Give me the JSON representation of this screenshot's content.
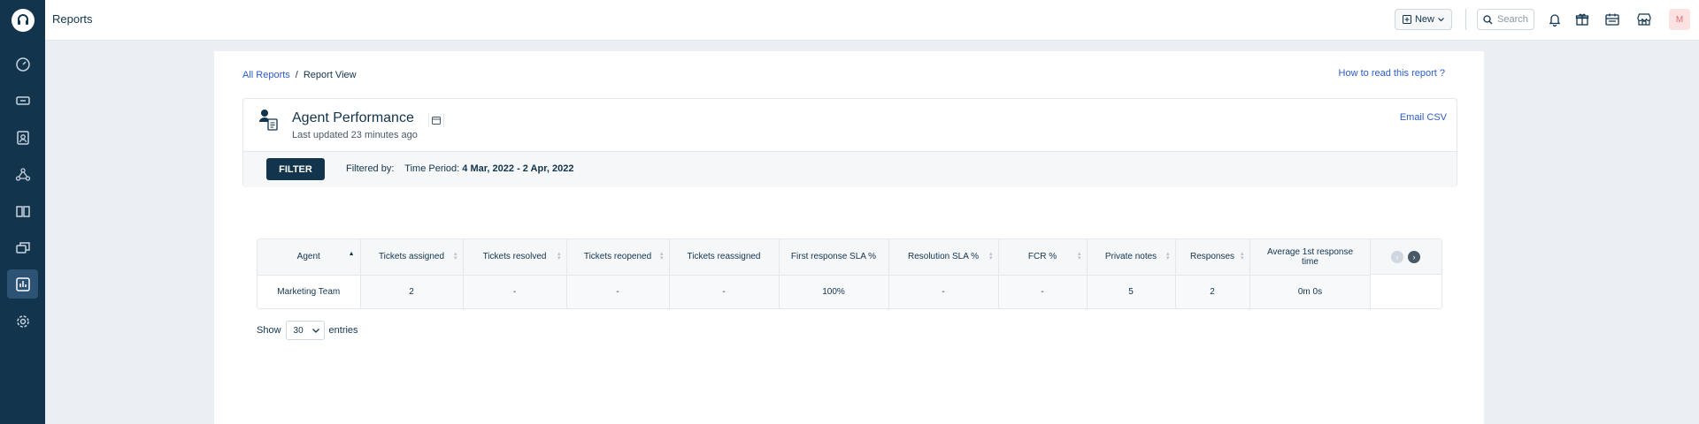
{
  "header": {
    "title": "Reports",
    "new_label": "New",
    "search_placeholder": "Search",
    "avatar_initial": "M"
  },
  "sidebar": {
    "items": [
      {
        "icon": "dashboard-icon"
      },
      {
        "icon": "tickets-icon"
      },
      {
        "icon": "contacts-icon"
      },
      {
        "icon": "groups-icon"
      },
      {
        "icon": "solutions-icon"
      },
      {
        "icon": "forums-icon"
      },
      {
        "icon": "reports-icon",
        "active": true
      },
      {
        "icon": "admin-gear-icon"
      }
    ]
  },
  "breadcrumb": {
    "root": "All Reports",
    "separator": "/",
    "current": "Report View"
  },
  "help_link": "How to read this report ?",
  "report": {
    "title": "Agent Performance",
    "last_updated": "Last updated 23 minutes ago",
    "email_csv": "Email CSV",
    "filter_button": "FILTER",
    "filtered_by_label": "Filtered by:",
    "time_period_label": "Time Period:",
    "time_period_value": "4 Mar, 2022 - 2 Apr, 2022"
  },
  "table": {
    "columns": [
      "Agent",
      "Tickets assigned",
      "Tickets resolved",
      "Tickets reopened",
      "Tickets reassigned",
      "First response SLA %",
      "Resolution SLA %",
      "FCR %",
      "Private notes",
      "Responses",
      "Average 1st response time"
    ],
    "rows": [
      [
        "Marketing Team",
        "2",
        "-",
        "-",
        "-",
        "100%",
        "-",
        "-",
        "5",
        "2",
        "0m 0s"
      ]
    ]
  },
  "pagination": {
    "show_label": "Show",
    "entries_value": "30",
    "entries_label": "entries"
  },
  "colors": {
    "sidebar_bg": "#12344d",
    "link": "#2c5cc5",
    "primary_button": "#12344d"
  }
}
